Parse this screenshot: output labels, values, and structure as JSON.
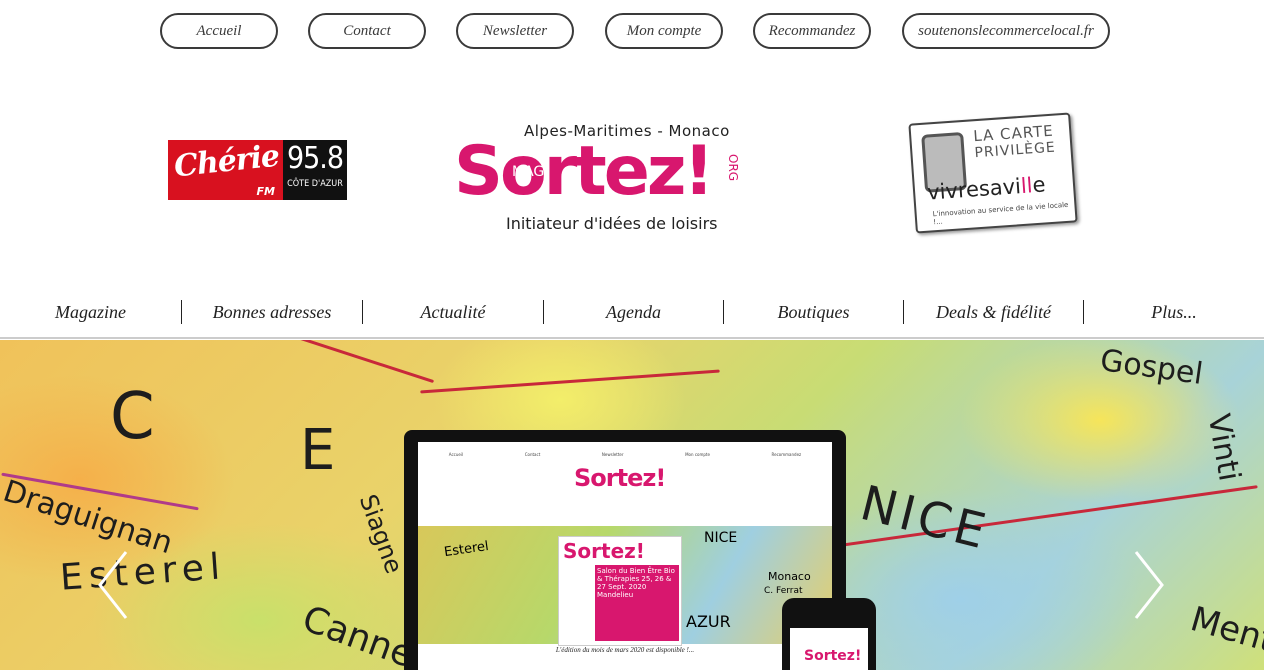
{
  "top_nav": [
    "Accueil",
    "Contact",
    "Newsletter",
    "Mon compte",
    "Recommandez",
    "soutenonslecommercelocal.fr"
  ],
  "logos": {
    "cherie": {
      "name": "Chérie",
      "suffix": "FM",
      "frequency": "95.8",
      "area": "CÔTE D'AZUR"
    },
    "sortez": {
      "region": "Alpes-Maritimes - Monaco",
      "brand": "Sortez!",
      "mag": "MAG",
      "org": "ORG",
      "tagline": "Initiateur d'idées de loisirs"
    },
    "vivresaville": {
      "line1": "LA CARTE",
      "line2": "PRIVILÈGE",
      "brand_a": "vivresa",
      "brand_b": "vi",
      "brand_c": "ll",
      "brand_d": "e",
      "tag": "L'innovation au service de la vie locale !..."
    }
  },
  "main_nav": [
    "Magazine",
    "Bonnes adresses",
    "Actualité",
    "Agenda",
    "Boutiques",
    "Deals & fidélité",
    "Plus..."
  ],
  "hero": {
    "map_labels": [
      "C",
      "E",
      "Draguignan",
      "Esterel",
      "Cannes",
      "Siagne",
      "NICE",
      "Gospel",
      "Vinti",
      "Ment"
    ],
    "screen": {
      "logo": "Sortez!",
      "poster_title": "Sortez!",
      "poster_text": "Salon du Bien Être Bio & Thérapies 25, 26 & 27 Sept. 2020 Mandelieu",
      "caption": "L'édition du mois de mars 2020 est disponible !...",
      "map_labels": [
        "Esterel",
        "NICE",
        "AZUR",
        "Monaco",
        "C. Ferrat"
      ]
    },
    "phone_logo": "Sortez!"
  },
  "colors": {
    "brand_pink": "#d8176e",
    "cherie_red": "#d8111f",
    "text_dark": "#222222"
  }
}
